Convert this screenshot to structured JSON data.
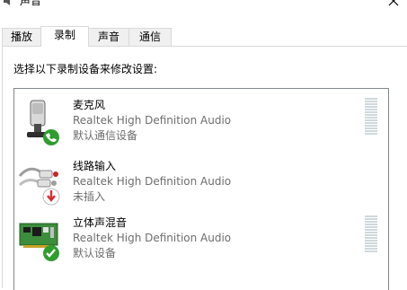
{
  "window": {
    "title": "声音"
  },
  "tabs": [
    {
      "label": "播放"
    },
    {
      "label": "录制"
    },
    {
      "label": "声音"
    },
    {
      "label": "通信"
    }
  ],
  "instruction": "选择以下录制设备来修改设置:",
  "devices": [
    {
      "name": "麦克风",
      "driver": "Realtek High Definition Audio",
      "status": "默认通信设备",
      "icon": "microphone-icon",
      "badge": "phone-badge-icon",
      "level_meter": true
    },
    {
      "name": "线路输入",
      "driver": "Realtek High Definition Audio",
      "status": "未插入",
      "icon": "line-in-jack-icon",
      "badge": "unplugged-arrow-badge-icon",
      "level_meter": false
    },
    {
      "name": "立体声混音",
      "driver": "Realtek High Definition Audio",
      "status": "默认设备",
      "icon": "sound-card-icon",
      "badge": "checkmark-badge-icon",
      "level_meter": true
    }
  ],
  "colors": {
    "badge_green": "#2f9e2f",
    "badge_red": "#d32f2f",
    "meter": "#cfd8dc"
  }
}
